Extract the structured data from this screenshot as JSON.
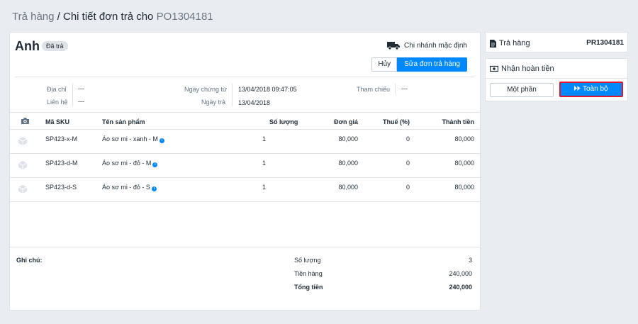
{
  "breadcrumb": {
    "parent": "Trả hàng",
    "sep": " / ",
    "current": "Chi tiết đơn trả cho ",
    "code": "PO1304181"
  },
  "order": {
    "customer": "Anh",
    "status": "Đã trả",
    "branch": "Chi nhánh mặc định",
    "cancel_label": "Hủy",
    "edit_label": "Sửa đơn trả hàng"
  },
  "details": {
    "address_label": "Địa chỉ",
    "address_value": "---",
    "contact_label": "Liên hệ",
    "contact_value": "---",
    "voucher_date_label": "Ngày chứng từ",
    "voucher_date_value": "13/04/2018 09:47:05",
    "return_date_label": "Ngày trả",
    "return_date_value": "13/04/2018",
    "reference_label": "Tham chiếu",
    "reference_value": "---"
  },
  "table": {
    "headers": {
      "sku": "Mã SKU",
      "name": "Tên sản phẩm",
      "qty": "Số lượng",
      "price": "Đơn giá",
      "tax": "Thuế (%)",
      "total": "Thành tiền"
    },
    "rows": [
      {
        "sku": "SP423-x-M",
        "name": "Áo sơ mi - xanh - M",
        "qty": "1",
        "price": "80,000",
        "tax": "0",
        "total": "80,000"
      },
      {
        "sku": "SP423-d-M",
        "name": "Áo sơ mi - đỏ - M",
        "qty": "1",
        "price": "80,000",
        "tax": "0",
        "total": "80,000"
      },
      {
        "sku": "SP423-d-S",
        "name": "Áo sơ mi - đỏ - S",
        "qty": "1",
        "price": "80,000",
        "tax": "0",
        "total": "80,000"
      }
    ]
  },
  "summary": {
    "note_label": "Ghi chú:",
    "qty_label": "Số lượng",
    "qty_value": "3",
    "subtotal_label": "Tiền hàng",
    "subtotal_value": "240,000",
    "total_label": "Tổng tiền",
    "total_value": "240,000"
  },
  "side": {
    "return_label": "Trả hàng",
    "return_code": "PR1304181",
    "refund_label": "Nhận hoàn tiền",
    "partial_label": "Một phần",
    "full_label": "Toàn bộ"
  },
  "colors": {
    "accent": "#0088ff",
    "highlight_border": "#e0182b",
    "background": "#e9edf2"
  }
}
